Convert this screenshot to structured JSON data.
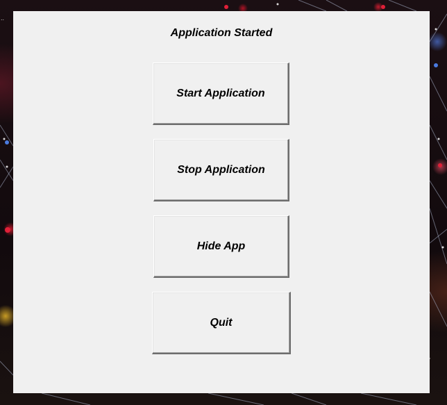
{
  "window": {
    "status_text": "Application Started"
  },
  "buttons": {
    "start_label": "Start Application",
    "stop_label": "Stop Application",
    "hide_label": "Hide App",
    "quit_label": "Quit"
  },
  "colors": {
    "dialog_background": "#f0f0f0",
    "text": "#000000",
    "wallpaper_base": "#14090c"
  }
}
